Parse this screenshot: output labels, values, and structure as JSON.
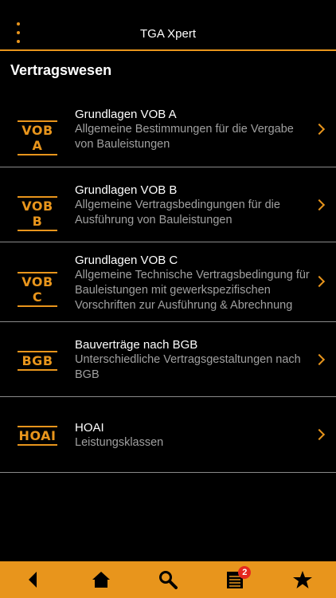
{
  "app": {
    "title": "TGA Xpert"
  },
  "section": {
    "title": "Vertragswesen"
  },
  "items": [
    {
      "badge": "VOB A",
      "title": "Grundlagen VOB A",
      "subtitle": "Allgemeine Bestimmungen für die Vergabe von Bauleistungen"
    },
    {
      "badge": "VOB B",
      "title": "Grundlagen VOB B",
      "subtitle": "Allgemeine Vertragsbedingungen für die Ausführung von Bauleistungen"
    },
    {
      "badge": "VOB C",
      "title": "Grundlagen VOB C",
      "subtitle": "Allgemeine Technische Vertragsbedingung für Bauleistungen mit gewerkspezifischen Vorschriften zur Ausführung & Abrechnung"
    },
    {
      "badge": "BGB",
      "title": "Bauverträge nach BGB",
      "subtitle": "Unterschiedliche Vertragsgestaltungen nach BGB"
    },
    {
      "badge": "HOAI",
      "title": "HOAI",
      "subtitle": "Leistungsklassen"
    }
  ],
  "tabbar": {
    "tabs": [
      {
        "icon": "back-icon"
      },
      {
        "icon": "home-icon"
      },
      {
        "icon": "search-icon"
      },
      {
        "icon": "list-icon",
        "badge_count": "2"
      },
      {
        "icon": "star-icon"
      }
    ]
  },
  "colors": {
    "accent": "#e8951c",
    "background": "#000000",
    "badge": "#e5281f"
  }
}
